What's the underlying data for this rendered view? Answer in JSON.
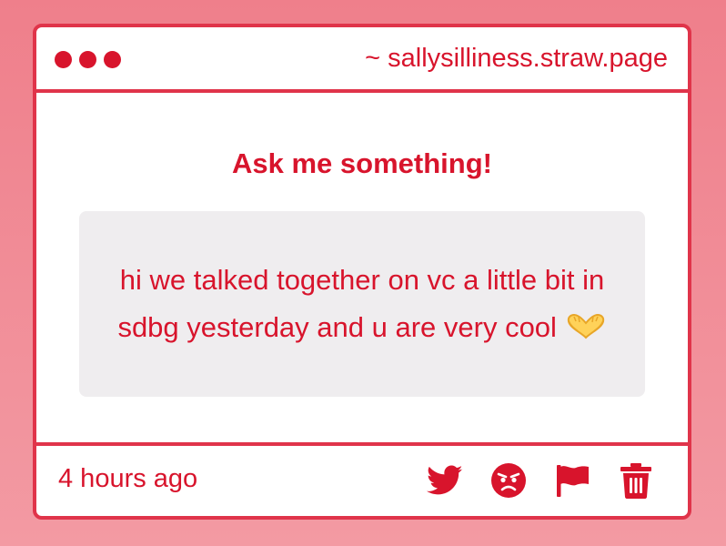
{
  "window": {
    "url": "~ sallysilliness.straw.page"
  },
  "content": {
    "heading": "Ask me something!",
    "message": "hi we talked together on vc a little bit in sdbg yesterday and u are very cool",
    "emoji": "heart-hands-emoji"
  },
  "footer": {
    "timestamp": "4 hours ago",
    "actions": [
      {
        "icon": "twitter-icon"
      },
      {
        "icon": "angry-face-icon"
      },
      {
        "icon": "flag-icon"
      },
      {
        "icon": "trash-icon"
      }
    ]
  },
  "colors": {
    "accent": "#d8142c",
    "border": "#e0344a",
    "background_top": "#ef7f8b",
    "background_bottom": "#f39aa3",
    "message_bg": "#efedef"
  }
}
